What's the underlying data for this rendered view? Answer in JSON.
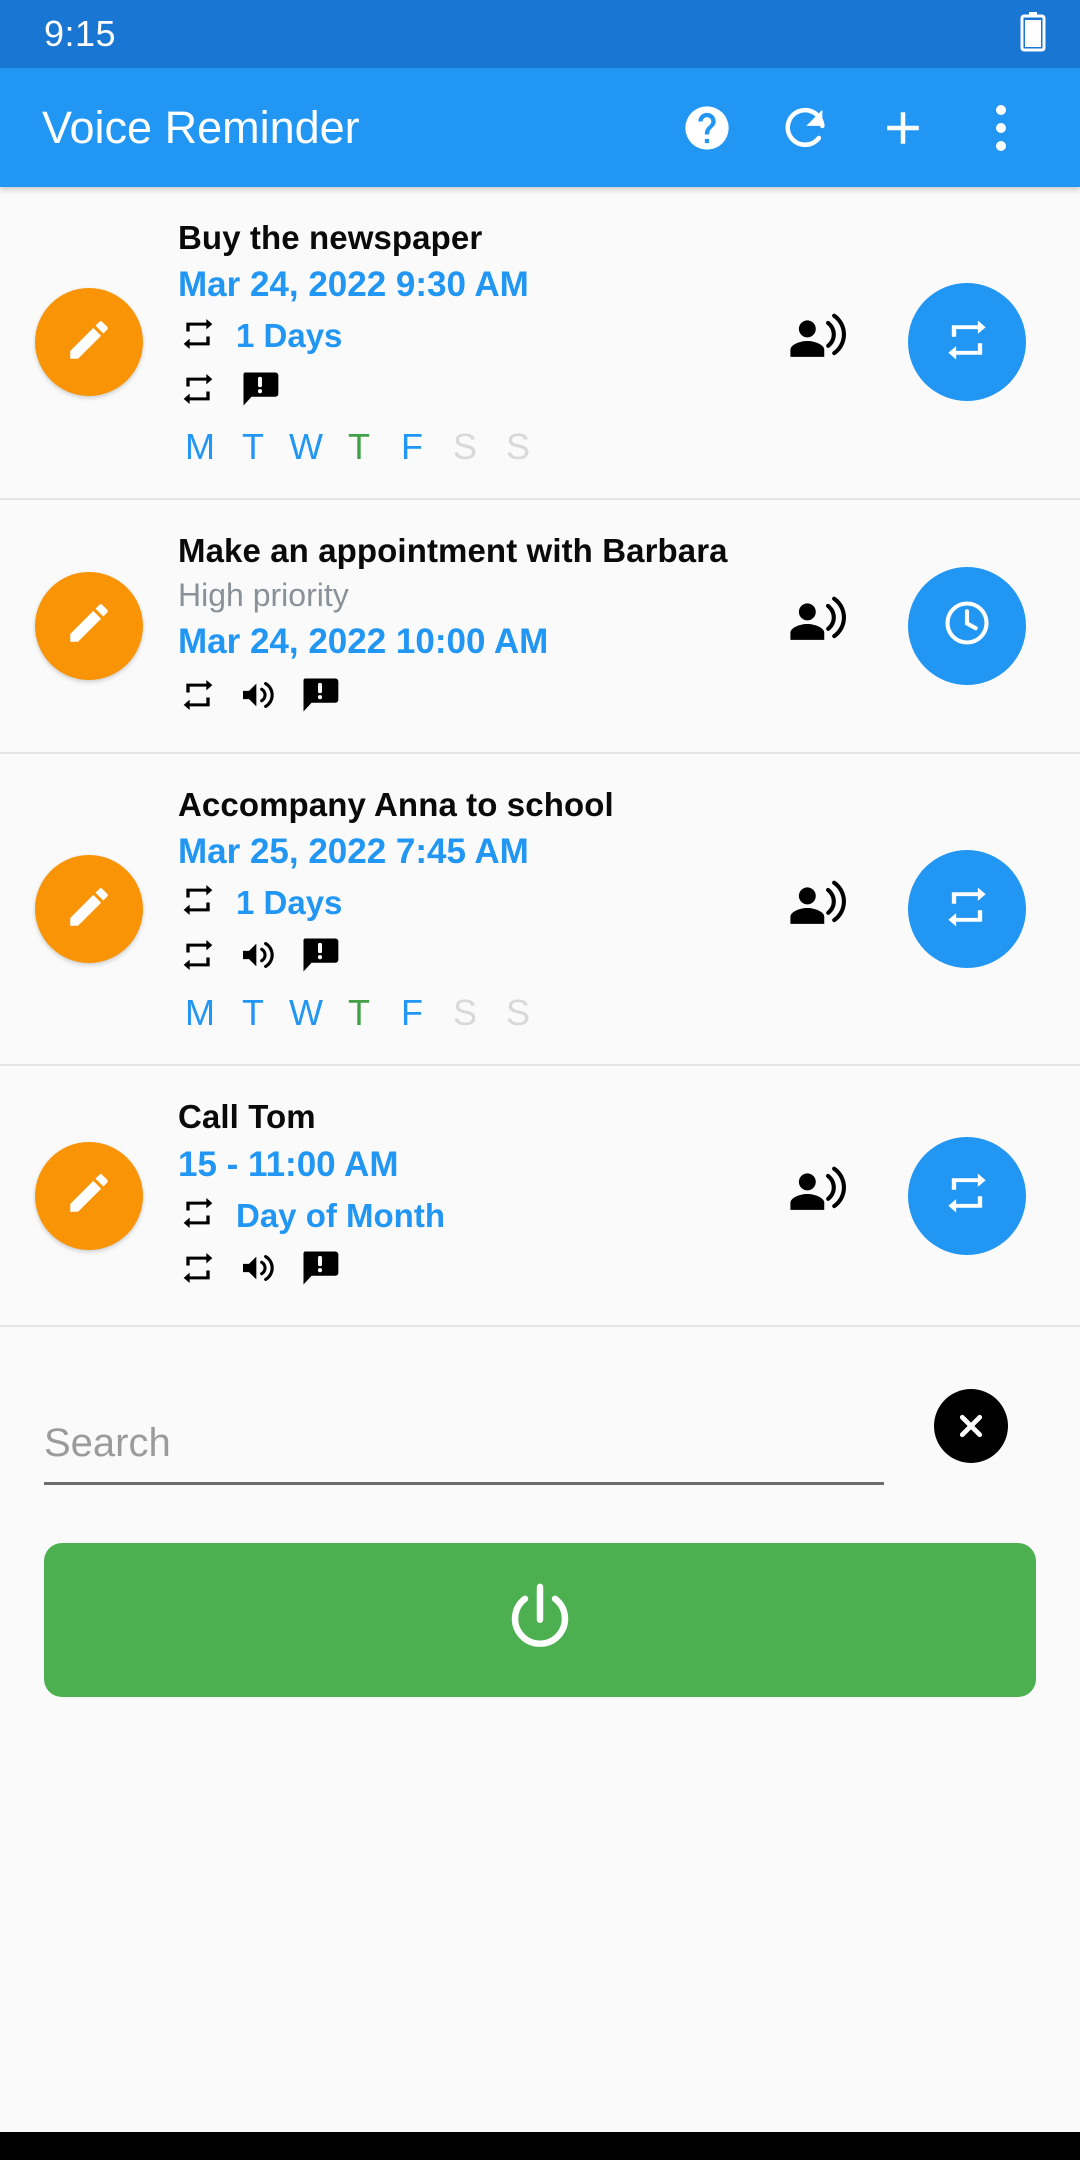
{
  "status_bar": {
    "time": "9:15",
    "battery_icon": "battery-icon"
  },
  "app_bar": {
    "title": "Voice Reminder",
    "actions": [
      {
        "name": "help-icon",
        "label": "Help"
      },
      {
        "name": "refresh-icon",
        "label": "Refresh"
      },
      {
        "name": "add-icon",
        "label": "Add"
      },
      {
        "name": "overflow-menu-icon",
        "label": "More options"
      }
    ]
  },
  "colors": {
    "status_bar": "#1976d2",
    "app_bar": "#2196f3",
    "accent_blue": "#2196f3",
    "edit_orange": "#f89406",
    "power_green": "#4caf50",
    "today_green": "#43a047",
    "day_off_gray": "#d9d9d9",
    "priority_gray": "#8a9199",
    "background": "#fafafa"
  },
  "reminders": [
    {
      "title": "Buy the newspaper",
      "priority": "",
      "datetime": "Mar 24, 2022 9:30 AM",
      "repeat_label": "1 Days",
      "has_repeat_line": true,
      "icons": [
        "repeat-icon",
        "alert-message-icon"
      ],
      "days": [
        {
          "letter": "M",
          "state": "on"
        },
        {
          "letter": "T",
          "state": "on"
        },
        {
          "letter": "W",
          "state": "on"
        },
        {
          "letter": "T",
          "state": "today"
        },
        {
          "letter": "F",
          "state": "on"
        },
        {
          "letter": "S",
          "state": "off"
        },
        {
          "letter": "S",
          "state": "off"
        }
      ],
      "edit_icon": "pencil-icon",
      "voice_icon": "record-voice-over-icon",
      "action_icon": "repeat-icon"
    },
    {
      "title": "Make an appointment with Barbara",
      "priority": "High priority",
      "datetime": "Mar 24, 2022 10:00 AM",
      "repeat_label": "",
      "has_repeat_line": false,
      "icons": [
        "repeat-icon",
        "volume-up-icon",
        "alert-message-icon"
      ],
      "days": [],
      "edit_icon": "pencil-icon",
      "voice_icon": "record-voice-over-icon",
      "action_icon": "clock-icon"
    },
    {
      "title": "Accompany Anna to school",
      "priority": "",
      "datetime": "Mar 25, 2022 7:45 AM",
      "repeat_label": "1 Days",
      "has_repeat_line": true,
      "icons": [
        "repeat-icon",
        "volume-up-icon",
        "alert-message-icon"
      ],
      "days": [
        {
          "letter": "M",
          "state": "on"
        },
        {
          "letter": "T",
          "state": "on"
        },
        {
          "letter": "W",
          "state": "on"
        },
        {
          "letter": "T",
          "state": "today"
        },
        {
          "letter": "F",
          "state": "on"
        },
        {
          "letter": "S",
          "state": "off"
        },
        {
          "letter": "S",
          "state": "off"
        }
      ],
      "edit_icon": "pencil-icon",
      "voice_icon": "record-voice-over-icon",
      "action_icon": "repeat-icon"
    },
    {
      "title": "Call Tom",
      "priority": "",
      "datetime": "15 - 11:00 AM",
      "repeat_label": "Day of Month",
      "has_repeat_line": true,
      "icons": [
        "repeat-icon",
        "volume-up-icon",
        "alert-message-icon"
      ],
      "days": [],
      "edit_icon": "pencil-icon",
      "voice_icon": "record-voice-over-icon",
      "action_icon": "repeat-icon"
    }
  ],
  "search": {
    "value": "",
    "placeholder": "Search",
    "clear_icon": "close-circle-icon"
  },
  "power": {
    "icon": "power-icon",
    "label": ""
  }
}
